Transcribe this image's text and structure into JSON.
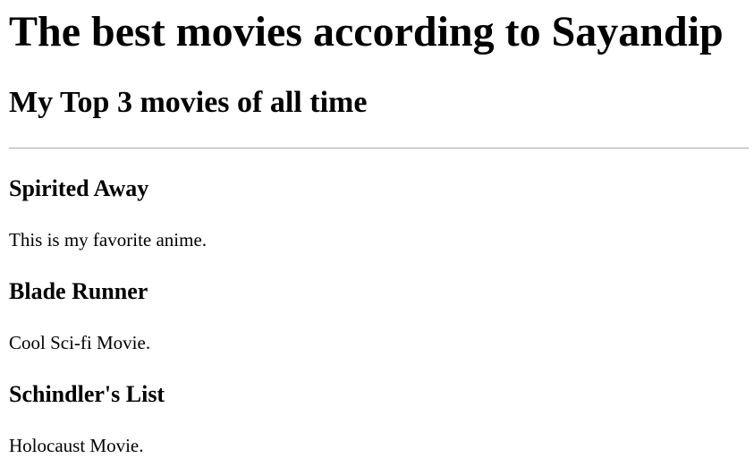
{
  "page": {
    "title": "The best movies according to Sayandip",
    "subtitle": "My Top 3 movies of all time"
  },
  "movies": [
    {
      "title": "Spirited Away",
      "description": "This is my favorite anime."
    },
    {
      "title": "Blade Runner",
      "description": "Cool Sci-fi Movie."
    },
    {
      "title": "Schindler's List",
      "description": "Holocaust Movie."
    }
  ]
}
